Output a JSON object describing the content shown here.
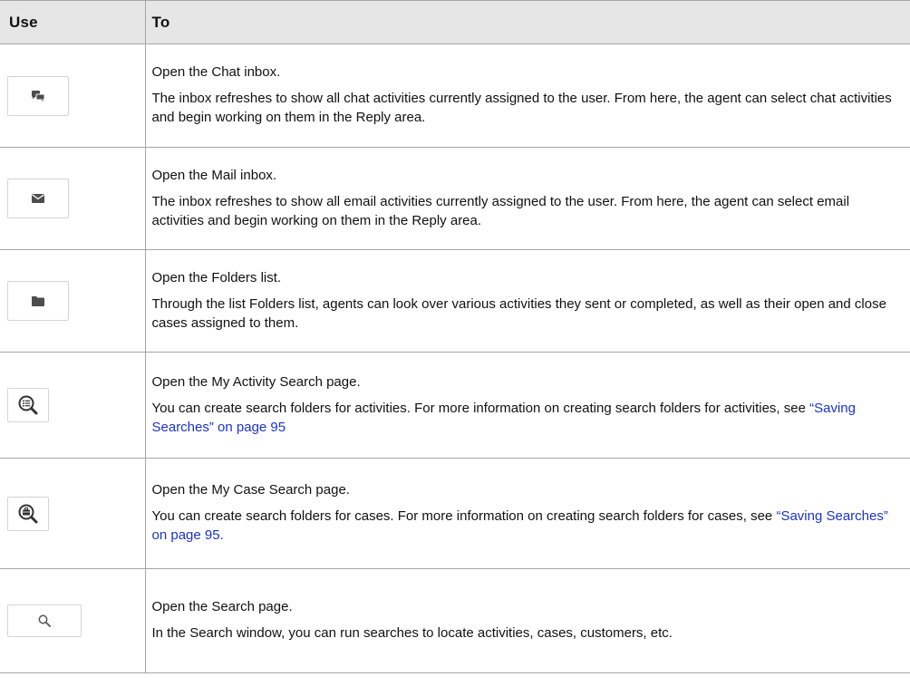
{
  "table": {
    "headers": {
      "use": "Use",
      "to": "To"
    },
    "rows": [
      {
        "icon": "chat-icon",
        "title": "Open the Chat inbox.",
        "desc": "The inbox refreshes to show all chat activities currently assigned to the user. From here, the agent can select chat activities and begin working on them in the Reply area."
      },
      {
        "icon": "mail-icon",
        "title": "Open the Mail inbox.",
        "desc": "The inbox refreshes to show all email activities currently assigned to the user. From here, the agent can select email activities and begin working on them in the Reply area."
      },
      {
        "icon": "folder-icon",
        "title": "Open the Folders list.",
        "desc": "Through the list Folders list, agents can look over various activities they sent or completed, as well as their open and close cases assigned to them."
      },
      {
        "icon": "activity-search-icon",
        "title": "Open the My Activity Search page.",
        "desc": "You can create search folders for activities. For more information on creating search folders for activities, see ",
        "link": "“Saving Searches” on page 95"
      },
      {
        "icon": "case-search-icon",
        "title": "Open the My Case Search page.",
        "desc": "You can create search folders for cases. For more information on creating search folders for cases, see ",
        "link": "“Saving Searches” on page 95."
      },
      {
        "icon": "search-icon",
        "title": "Open the Search page.",
        "desc": "In the Search window, you can run searches to locate activities, cases, customers, etc."
      }
    ]
  }
}
